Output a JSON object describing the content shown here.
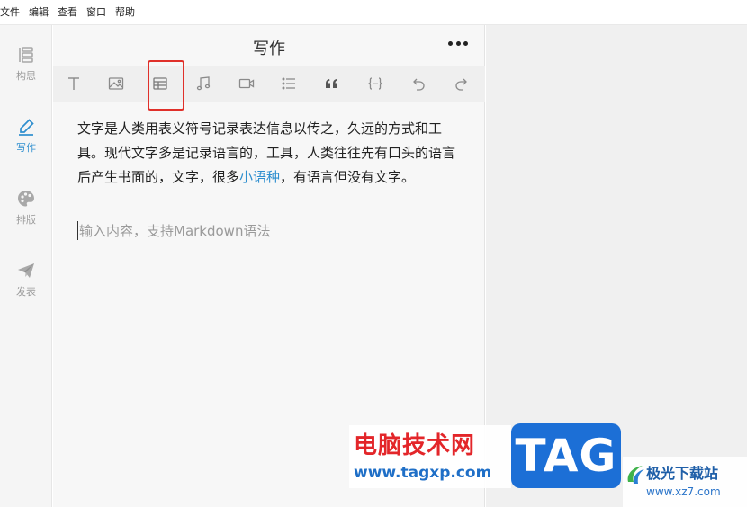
{
  "menu": [
    "文件",
    "编辑",
    "查看",
    "窗口",
    "帮助"
  ],
  "sidebar": {
    "items": [
      {
        "label": "构思",
        "icon": "outline-icon",
        "active": false
      },
      {
        "label": "写作",
        "icon": "pen-icon",
        "active": true
      },
      {
        "label": "排版",
        "icon": "palette-icon",
        "active": false
      },
      {
        "label": "发表",
        "icon": "paper-plane-icon",
        "active": false
      }
    ]
  },
  "editor": {
    "title": "写作",
    "toolbar": [
      "text-icon",
      "image-icon",
      "table-icon",
      "music-icon",
      "video-icon",
      "list-icon",
      "quote-icon",
      "code-icon",
      "undo-icon",
      "redo-icon"
    ],
    "content": {
      "before_link": "文字是人类用表义符号记录表达信息以传之，久远的方式和工具。现代文字多是记录语言的，工具，人类往往先有口头的语言后产生书面的，文字，很多",
      "link": "小语种",
      "after_link": "，有语言但没有文字。"
    },
    "placeholder": "输入内容，支持Markdown语法"
  },
  "colors": {
    "accent": "#2f8fcf",
    "highlight_box": "#e0302a"
  },
  "watermark": {
    "site_cn": "电脑技术网",
    "site_url": "www.tagxp.com",
    "badge": "TAG",
    "logo_cn": "极光下载站",
    "logo_url": "www.xz7.com"
  }
}
